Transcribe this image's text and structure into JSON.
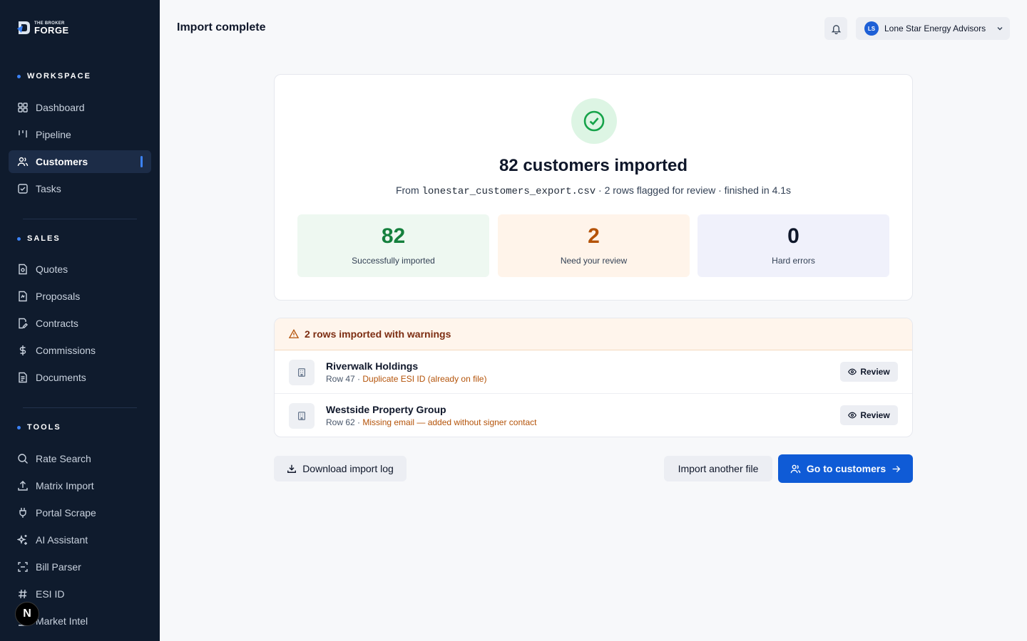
{
  "brand": {
    "small": "THE BROKER",
    "big": "FORGE"
  },
  "sidebar": {
    "sections": [
      {
        "label": "WORKSPACE",
        "items": [
          {
            "label": "Dashboard",
            "icon": "grid-icon"
          },
          {
            "label": "Pipeline",
            "icon": "pipeline-icon"
          },
          {
            "label": "Customers",
            "icon": "users-icon",
            "active": true
          },
          {
            "label": "Tasks",
            "icon": "checkbox-icon"
          }
        ]
      },
      {
        "label": "SALES",
        "items": [
          {
            "label": "Quotes",
            "icon": "quote-doc-icon"
          },
          {
            "label": "Proposals",
            "icon": "proposal-doc-icon"
          },
          {
            "label": "Contracts",
            "icon": "contract-icon"
          },
          {
            "label": "Commissions",
            "icon": "dollar-icon"
          },
          {
            "label": "Documents",
            "icon": "document-icon"
          }
        ]
      },
      {
        "label": "TOOLS",
        "items": [
          {
            "label": "Rate Search",
            "icon": "search-icon"
          },
          {
            "label": "Matrix Import",
            "icon": "upload-icon"
          },
          {
            "label": "Portal Scrape",
            "icon": "plug-icon"
          },
          {
            "label": "AI Assistant",
            "icon": "sparkles-icon"
          },
          {
            "label": "Bill Parser",
            "icon": "scan-icon"
          },
          {
            "label": "ESI ID",
            "icon": "hash-icon"
          },
          {
            "label": "Market Intel",
            "icon": "chart-icon"
          }
        ]
      }
    ],
    "badge": "N"
  },
  "header": {
    "title": "Import complete",
    "account": {
      "initials": "LS",
      "name": "Lone Star Energy Advisors"
    }
  },
  "summary": {
    "headline": "82 customers imported",
    "sub_prefix": "From ",
    "filename": "lonestar_customers_export.csv",
    "sub_suffix": " · 2 rows flagged for review · finished in 4.1s",
    "stats": [
      {
        "value": "82",
        "label": "Successfully imported",
        "color": "#15803d",
        "bg": "#eef8f1"
      },
      {
        "value": "2",
        "label": "Need your review",
        "color": "#b45309",
        "bg": "#fff4ea"
      },
      {
        "value": "0",
        "label": "Hard errors",
        "color": "#0f172a",
        "bg": "#f0f1fb"
      }
    ]
  },
  "warnings": {
    "title": "2 rows imported with warnings",
    "rows": [
      {
        "name": "Riverwalk Holdings",
        "row": "Row 47 · ",
        "message": "Duplicate ESI ID (already on file)",
        "action": "Review"
      },
      {
        "name": "Westside Property Group",
        "row": "Row 62 · ",
        "message": "Missing email — added without signer contact",
        "action": "Review"
      }
    ]
  },
  "actions": {
    "download": "Download import log",
    "import_another": "Import another file",
    "go_customers": "Go to customers"
  }
}
